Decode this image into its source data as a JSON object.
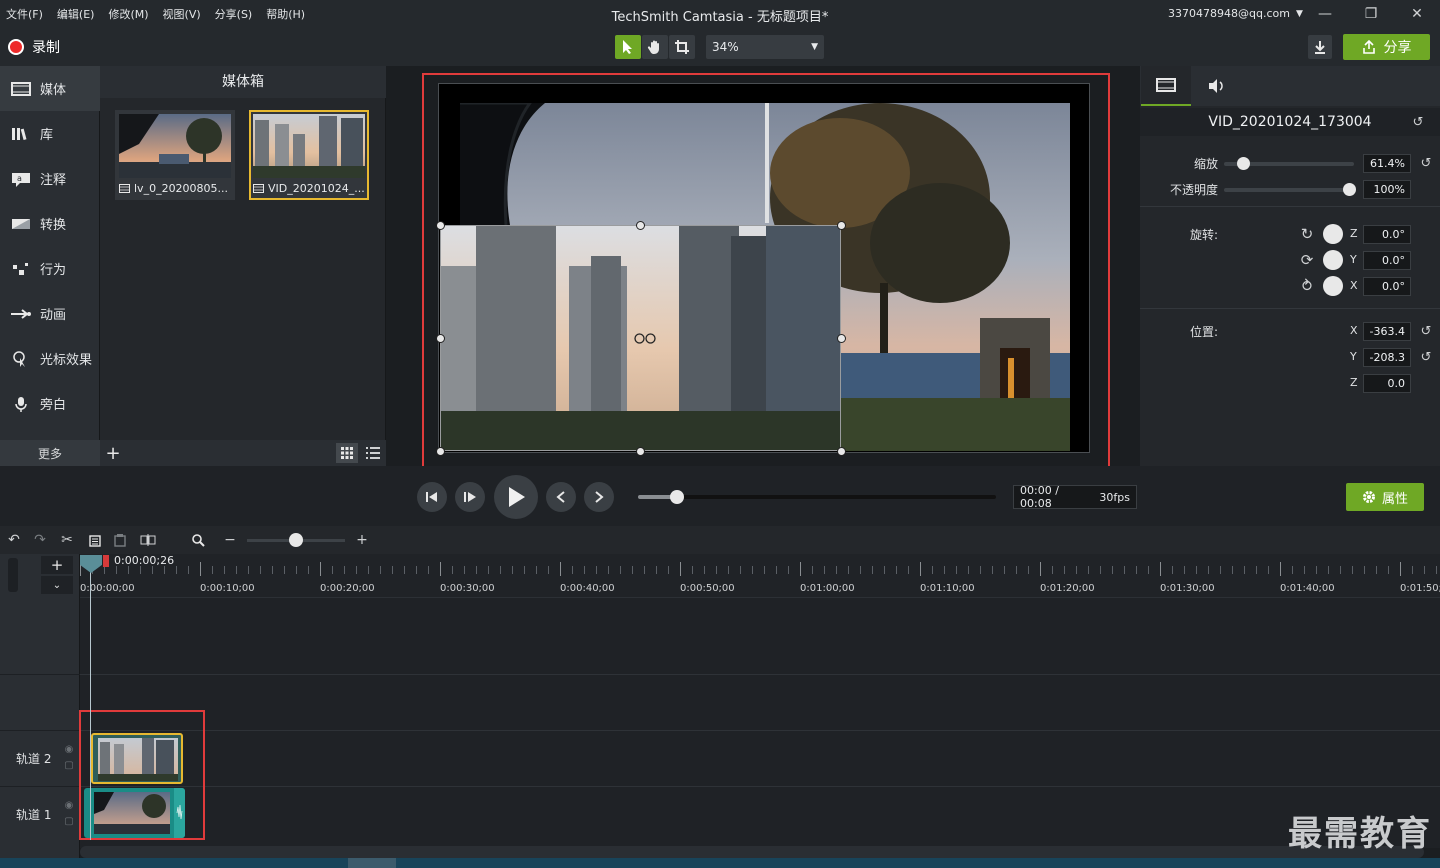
{
  "window": {
    "title": "TechSmith Camtasia - 无标题项目*",
    "account": "3370478948@qq.com",
    "menu": [
      "文件(F)",
      "编辑(E)",
      "修改(M)",
      "视图(V)",
      "分享(S)",
      "帮助(H)"
    ],
    "controls": [
      "minimize-icon",
      "restore-icon",
      "close-icon"
    ]
  },
  "toolbar": {
    "record_label": "录制",
    "zoom": "34%",
    "share_label": "分享",
    "accent": "#6fa825",
    "record_color": "#ee2b2b"
  },
  "sidebar": {
    "items": [
      {
        "label": "媒体",
        "icon": "film-icon"
      },
      {
        "label": "库",
        "icon": "library-icon"
      },
      {
        "label": "注释",
        "icon": "annotation-icon"
      },
      {
        "label": "转换",
        "icon": "transition-icon"
      },
      {
        "label": "行为",
        "icon": "behavior-icon"
      },
      {
        "label": "动画",
        "icon": "animation-icon"
      },
      {
        "label": "光标效果",
        "icon": "cursor-effect-icon"
      },
      {
        "label": "旁白",
        "icon": "microphone-icon"
      }
    ],
    "more_label": "更多"
  },
  "media_bin": {
    "title": "媒体箱",
    "items": [
      {
        "name": "lv_0_20200805...",
        "selected": false
      },
      {
        "name": "VID_20201024_...",
        "selected": true
      }
    ]
  },
  "playback": {
    "time": "00:00 / 00:08",
    "fps": "30fps",
    "properties_label": "属性"
  },
  "properties": {
    "clip_name": "VID_20201024_173004",
    "scale": {
      "label": "缩放",
      "value": "61.4%"
    },
    "opacity": {
      "label": "不透明度",
      "value": "100%"
    },
    "rotation": {
      "label": "旋转:",
      "z": "0.0°",
      "y": "0.0°",
      "x": "0.0°"
    },
    "position": {
      "label": "位置:",
      "x": "-363.4",
      "y": "-208.3",
      "z": "0.0"
    },
    "axes": {
      "x": "X",
      "y": "Y",
      "z": "Z"
    }
  },
  "timeline": {
    "playhead_time": "0:00:00;26",
    "ticks": [
      "0:00:00;00",
      "0:00:10;00",
      "0:00:20;00",
      "0:00:30;00",
      "0:00:40;00",
      "0:00:50;00",
      "0:01:00;00",
      "0:01:10;00",
      "0:01:20;00",
      "0:01:30;00",
      "0:01:40;00",
      "0:01:50;"
    ],
    "tracks": [
      "轨道 2",
      "轨道 1"
    ]
  },
  "watermark": "最需教育"
}
